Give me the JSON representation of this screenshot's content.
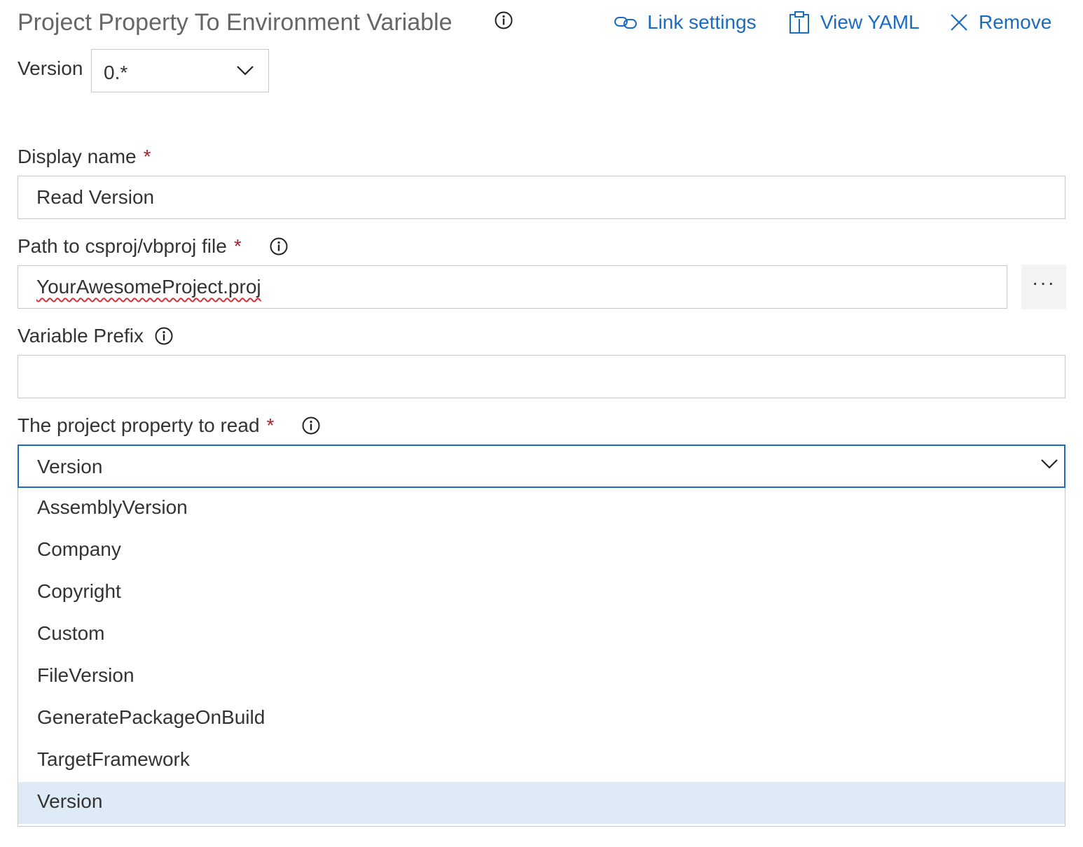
{
  "header": {
    "title": "Project Property To Environment Variable",
    "actions": {
      "link_settings": "Link settings",
      "view_yaml": "View YAML",
      "remove": "Remove"
    },
    "accent_color": "#1a6bc2"
  },
  "version": {
    "label": "Version",
    "value": "0.*"
  },
  "fields": {
    "display_name": {
      "label": "Display name",
      "required_mark": "*",
      "value": "Read Version"
    },
    "path": {
      "label": "Path to csproj/vbproj file",
      "required_mark": "*",
      "value": "YourAwesomeProject.proj",
      "browse_label": "···"
    },
    "variable_prefix": {
      "label": "Variable Prefix",
      "value": ""
    },
    "property": {
      "label": "The project property to read",
      "required_mark": "*",
      "value": "Version",
      "options": [
        "AssemblyVersion",
        "Company",
        "Copyright",
        "Custom",
        "FileVersion",
        "GeneratePackageOnBuild",
        "TargetFramework",
        "Version"
      ],
      "selected_index": 7
    }
  },
  "icons": [
    "info-icon",
    "link-icon",
    "clipboard-icon",
    "close-icon",
    "chevron-down-icon"
  ]
}
